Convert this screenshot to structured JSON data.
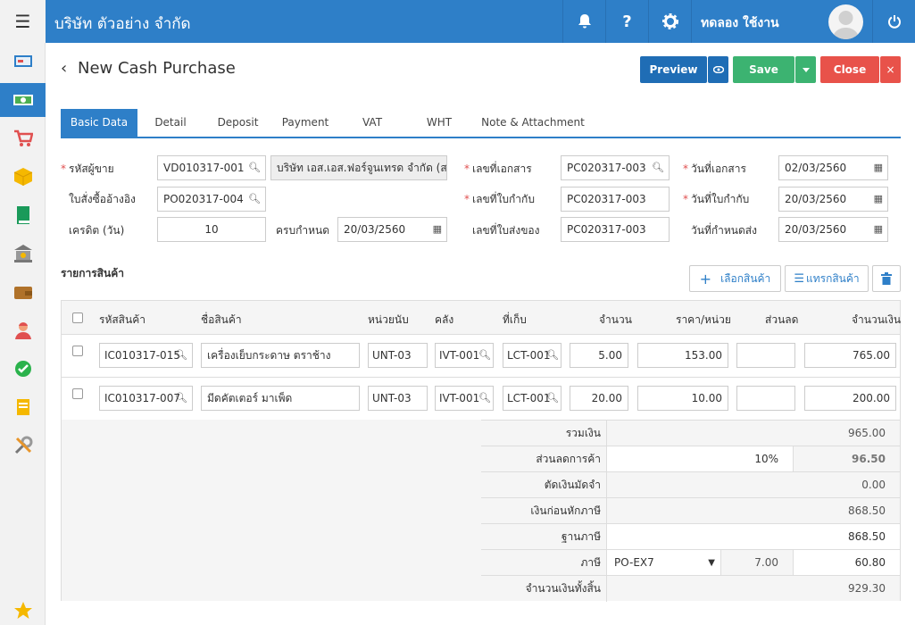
{
  "topbar": {
    "company": "บริษัท ตัวอย่าง จำกัด",
    "user": "ทดลอง ใช้งาน"
  },
  "page": {
    "title": "New Cash Purchase"
  },
  "actions": {
    "preview": "Preview",
    "save": "Save",
    "close": "Close"
  },
  "tabs": [
    "Basic Data",
    "Detail",
    "Deposit",
    "Payment",
    "VAT",
    "WHT",
    "Note & Attachment"
  ],
  "form": {
    "vendor_code_label": "รหัสผู้ขาย",
    "vendor_code": "VD010317-001",
    "vendor_name": "บริษัท เอส.เอส.ฟอร์จูนเทรด จำกัด (ส",
    "po_ref_label": "ใบสั่งซื้ออ้างอิง",
    "po_ref": "PO020317-004",
    "credit_label": "เครดิต (วัน)",
    "credit": "10",
    "due_label": "ครบกำหนด",
    "due": "20/03/2560",
    "doc_no_label": "เลขที่เอกสาร",
    "doc_no": "PC020317-003",
    "receipt_no_label": "เลขที่ใบกำกับ",
    "receipt_no": "PC020317-003",
    "delivery_no_label": "เลขที่ใบส่งของ",
    "delivery_no": "PC020317-003",
    "doc_date_label": "วันที่เอกสาร",
    "doc_date": "02/03/2560",
    "receipt_date_label": "วันที่ใบกำกับ",
    "receipt_date": "20/03/2560",
    "delivery_date_label": "วันที่กำหนดส่ง",
    "delivery_date": "20/03/2560"
  },
  "items_section": {
    "title": "รายการสินค้า",
    "select_btn": "เลือกสินค้า",
    "insert_btn": "แทรกสินค้า"
  },
  "grid": {
    "headers": {
      "code": "รหัสสินค้า",
      "name": "ชื่อสินค้า",
      "unit": "หน่วยนับ",
      "wh": "คลัง",
      "loc": "ที่เก็บ",
      "qty": "จำนวน",
      "price": "ราคา/หน่วย",
      "disc": "ส่วนลด",
      "amount": "จำนวนเงิน"
    },
    "rows": [
      {
        "code": "IC010317-015",
        "name": "เครื่องเย็บกระดาษ ตราช้าง",
        "unit": "UNT-03",
        "wh": "IVT-001",
        "loc": "LCT-001",
        "qty": "5.00",
        "price": "153.00",
        "disc": "",
        "amount": "765.00"
      },
      {
        "code": "IC010317-007",
        "name": "มีดคัตเตอร์ มาเพ็ด",
        "unit": "UNT-03",
        "wh": "IVT-001",
        "loc": "LCT-001",
        "qty": "20.00",
        "price": "10.00",
        "disc": "",
        "amount": "200.00"
      }
    ]
  },
  "summary": {
    "total_label": "รวมเงิน",
    "total": "965.00",
    "discount_label": "ส่วนลดการค้า",
    "discount_pct": "10%",
    "discount": "96.50",
    "deposit_label": "ตัดเงินมัดจำ",
    "deposit": "0.00",
    "before_vat_label": "เงินก่อนหักภาษี",
    "before_vat": "868.50",
    "base_label": "ฐานภาษี",
    "base": "868.50",
    "vat_label": "ภาษี",
    "vat_code": "PO-EX7",
    "vat_rate": "7.00",
    "vat": "60.80",
    "net_label": "จำนวนเงินทั้งสิ้น",
    "net": "929.30"
  },
  "colors": {
    "primary": "#2e7fc8",
    "preview": "#1f6db5",
    "save": "#3cb371",
    "close": "#e8524a"
  }
}
